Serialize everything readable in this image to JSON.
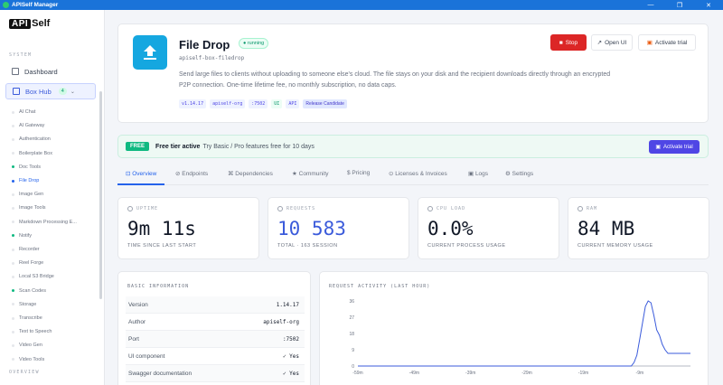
{
  "window": {
    "title": "APISelf Manager",
    "minimize": "—",
    "maximize": "❐",
    "close": "✕"
  },
  "logo": {
    "api": "API",
    "self": "Self"
  },
  "sidebar": {
    "system_label": "SYSTEM",
    "overview_label": "OVERVIEW",
    "dashboard": "Dashboard",
    "box_hub": "Box Hub",
    "box_hub_count": "4",
    "items": [
      {
        "label": "AI Chat",
        "status": "none"
      },
      {
        "label": "AI Gateway",
        "status": "none"
      },
      {
        "label": "Authentication",
        "status": "none"
      },
      {
        "label": "Boilerplate Box",
        "status": "none"
      },
      {
        "label": "Doc Tools",
        "status": "running"
      },
      {
        "label": "File Drop",
        "status": "active"
      },
      {
        "label": "Image Gen",
        "status": "none"
      },
      {
        "label": "Image Tools",
        "status": "none"
      },
      {
        "label": "Markdown Processing E...",
        "status": "none"
      },
      {
        "label": "Notify",
        "status": "running"
      },
      {
        "label": "Recorder",
        "status": "none"
      },
      {
        "label": "Reel Forge",
        "status": "none"
      },
      {
        "label": "Local S3 Bridge",
        "status": "none"
      },
      {
        "label": "Scan Codes",
        "status": "running"
      },
      {
        "label": "Storage",
        "status": "none"
      },
      {
        "label": "Transcribe",
        "status": "none"
      },
      {
        "label": "Text to Speech",
        "status": "none"
      },
      {
        "label": "Video Gen",
        "status": "none"
      },
      {
        "label": "Video Tools",
        "status": "none"
      }
    ]
  },
  "header": {
    "title": "File Drop",
    "status": "● running",
    "package": "apiself-box-filedrop",
    "description": "Send large files to clients without uploading to someone else's cloud. The file stays on your disk and the recipient downloads directly through an encrypted P2P connection. One-time lifetime fee, no monthly subscription, no data caps.",
    "tags": [
      "v1.14.17",
      "apiself-org",
      ":7502",
      "UI",
      "API",
      "Release Candidate"
    ],
    "stop_label": "Stop",
    "open_ui_label": "Open UI",
    "activate_label": "Activate trial"
  },
  "free_tier": {
    "badge": "FREE",
    "title": "Free tier active",
    "text": "Try Basic / Pro features free for 10 days",
    "button": "Activate trial"
  },
  "tabs": [
    {
      "label": "⊡ Overview",
      "active": true
    },
    {
      "label": "⊘ Endpoints"
    },
    {
      "label": "⌘ Dependencies"
    },
    {
      "label": "★ Community"
    },
    {
      "label": "$ Pricing"
    },
    {
      "label": "⊙ Licenses & Invoices"
    },
    {
      "label": "▣ Logs"
    },
    {
      "label": "⚙ Settings"
    }
  ],
  "stats": [
    {
      "label": "UPTIME",
      "value": "9m 11s",
      "sub": "TIME SINCE LAST START"
    },
    {
      "label": "REQUESTS",
      "value": "10 583",
      "sub": "TOTAL · 163 SESSION"
    },
    {
      "label": "CPU LOAD",
      "value": "0.0%",
      "sub": "CURRENT PROCESS USAGE"
    },
    {
      "label": "RAM",
      "value": "84 MB",
      "sub": "CURRENT MEMORY USAGE"
    }
  ],
  "basic_info": {
    "title": "BASIC INFORMATION",
    "rows": [
      {
        "key": "Version",
        "value": "1.14.17"
      },
      {
        "key": "Author",
        "value": "apiself-org"
      },
      {
        "key": "Port",
        "value": ":7502"
      },
      {
        "key": "UI component",
        "value": "✓ Yes"
      },
      {
        "key": "Swagger documentation",
        "value": "✓ Yes"
      }
    ]
  },
  "chart_data": {
    "type": "line",
    "title": "REQUEST ACTIVITY (LAST HOUR)",
    "xlabel": "",
    "ylabel": "",
    "x_ticks": [
      "-59m",
      "-49m",
      "-39m",
      "-29m",
      "-19m",
      "-9m"
    ],
    "y_ticks": [
      0,
      9,
      18,
      27,
      36
    ],
    "xlim": [
      -59,
      0
    ],
    "ylim": [
      0,
      36
    ],
    "grid": false,
    "color": "#3b5bdb",
    "x": [
      -59,
      -10.5,
      -10,
      -9.5,
      -9,
      -8.5,
      -8,
      -7.5,
      -7,
      -6.5,
      -6,
      -5.5,
      -5,
      -4.5,
      -4,
      -3.5,
      -3,
      -2,
      -1,
      0
    ],
    "y": [
      0,
      0,
      2,
      6,
      15,
      24,
      33,
      36,
      35,
      28,
      20,
      17,
      12,
      9,
      7,
      7,
      7,
      7,
      7,
      7
    ]
  }
}
